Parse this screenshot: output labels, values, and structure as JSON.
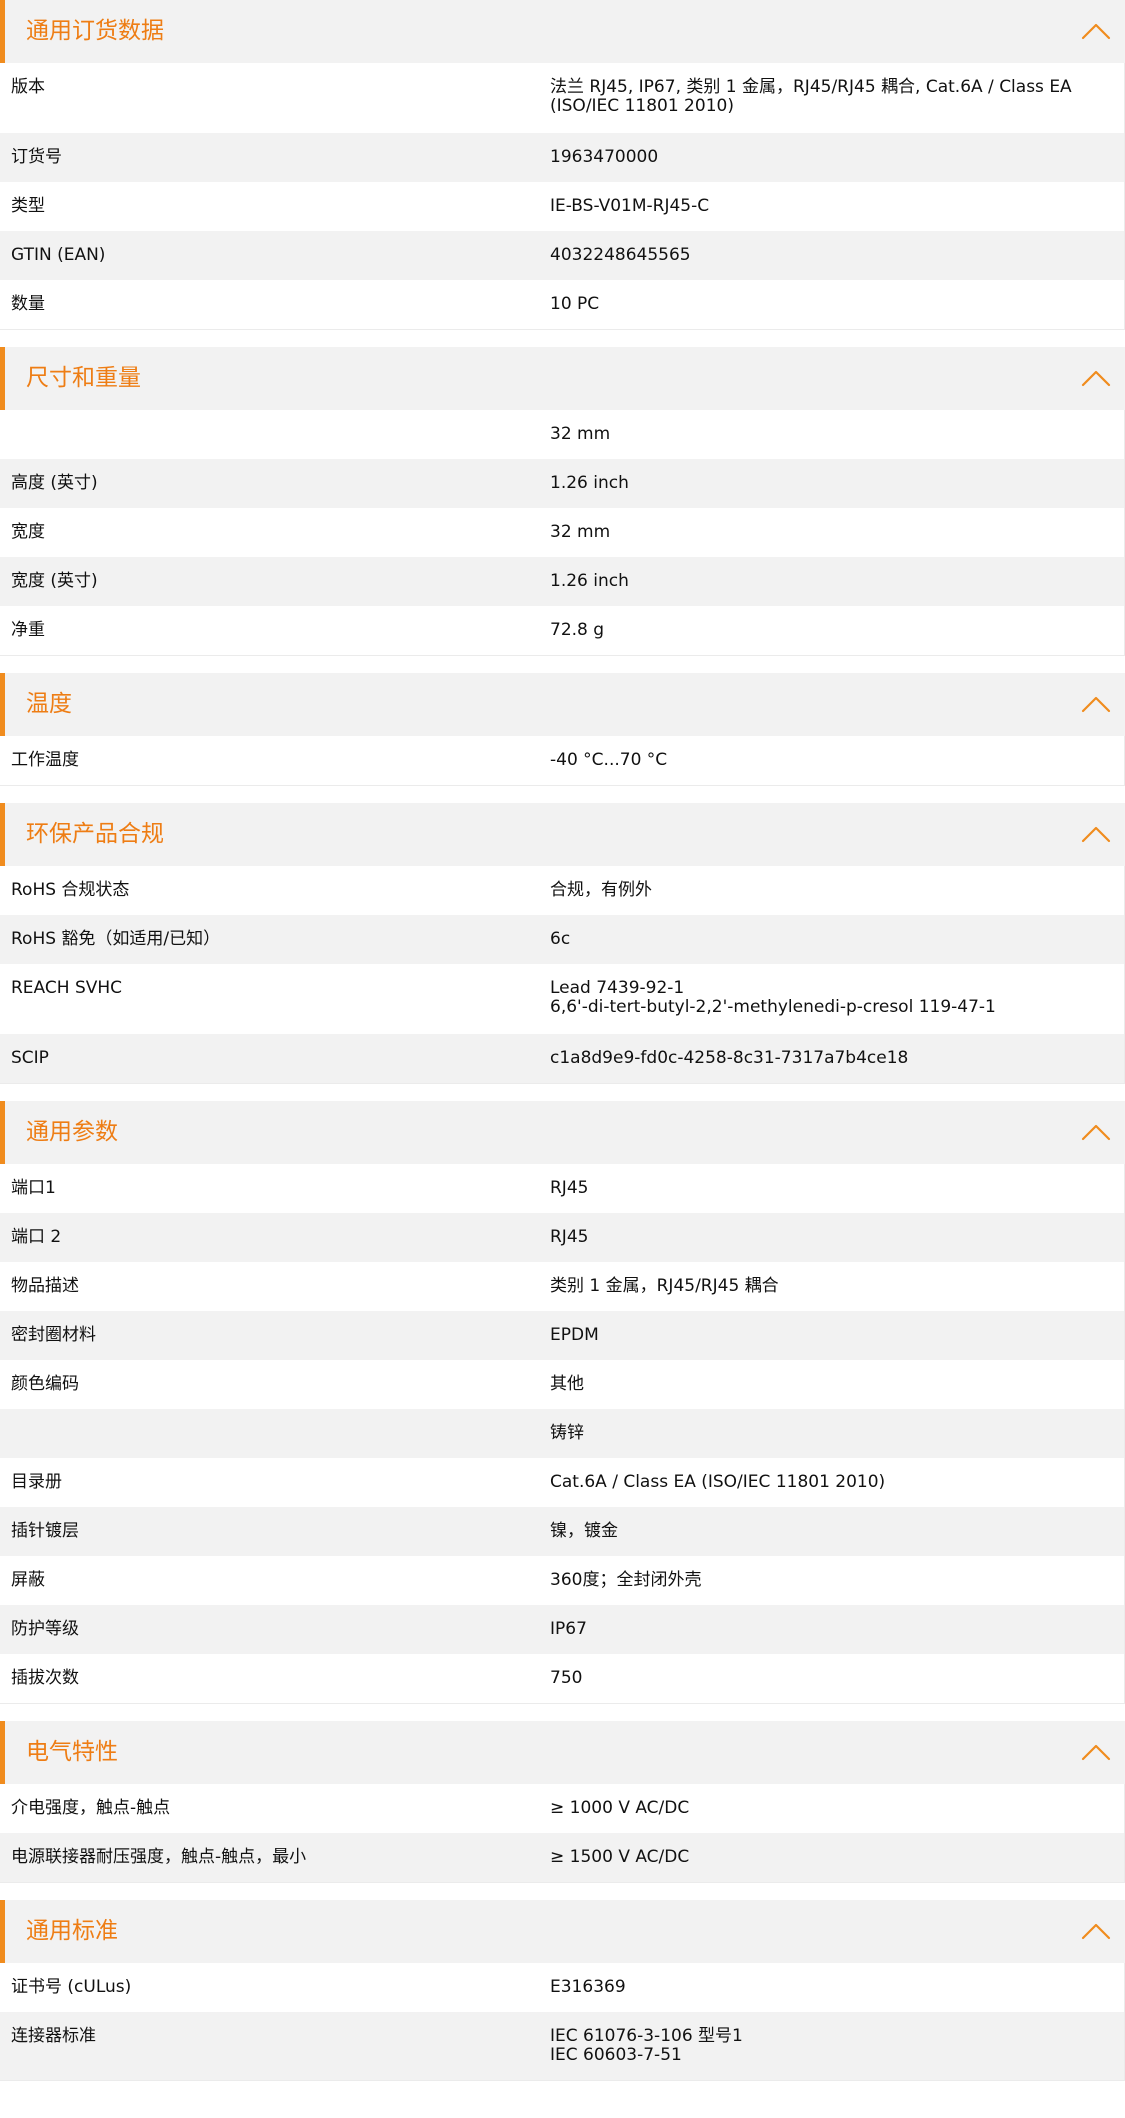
{
  "accent_color": "#f08c1e",
  "collapse_icon": "chevron-up-icon",
  "sections": [
    {
      "title": "通用订货数据",
      "rows": [
        {
          "label": "版本",
          "value": [
            "法兰 RJ45, IP67, 类别 1 金属，RJ45/RJ45 耦合, Cat.6A / Class EA",
            "(ISO/IEC 11801 2010)"
          ]
        },
        {
          "label": "订货号",
          "value": [
            "1963470000"
          ]
        },
        {
          "label": "类型",
          "value": [
            "IE-BS-V01M-RJ45-C"
          ]
        },
        {
          "label": "GTIN (EAN)",
          "value": [
            "4032248645565"
          ]
        },
        {
          "label": "数量",
          "value": [
            "10  PC"
          ]
        }
      ]
    },
    {
      "title": "尺寸和重量",
      "rows": [
        {
          "label": "",
          "value": [
            "32  mm"
          ]
        },
        {
          "label": "高度 (英寸)",
          "value": [
            "1.26  inch"
          ]
        },
        {
          "label": "宽度",
          "value": [
            "32  mm"
          ]
        },
        {
          "label": "宽度 (英寸)",
          "value": [
            "1.26  inch"
          ]
        },
        {
          "label": "净重",
          "value": [
            "72.8  g"
          ]
        }
      ]
    },
    {
      "title": "温度",
      "rows": [
        {
          "label": "工作温度",
          "value": [
            "-40 °C...70 °C"
          ]
        }
      ]
    },
    {
      "title": "环保产品合规",
      "rows": [
        {
          "label": "RoHS 合规状态",
          "value": [
            "合规，有例外"
          ]
        },
        {
          "label": "RoHS 豁免（如适用/已知）",
          "value": [
            "6c"
          ]
        },
        {
          "label": "REACH SVHC",
          "value": [
            "Lead 7439-92-1",
            "6,6'-di-tert-butyl-2,2'-methylenedi-p-cresol 119-47-1"
          ]
        },
        {
          "label": "SCIP",
          "value": [
            "c1a8d9e9-fd0c-4258-8c31-7317a7b4ce18"
          ]
        }
      ]
    },
    {
      "title": "通用参数",
      "rows": [
        {
          "label": "端口1",
          "value": [
            "RJ45"
          ]
        },
        {
          "label": "端口 2",
          "value": [
            "RJ45"
          ]
        },
        {
          "label": "物品描述",
          "value": [
            "类别 1 金属，RJ45/RJ45 耦合"
          ]
        },
        {
          "label": "密封圈材料",
          "value": [
            "EPDM"
          ]
        },
        {
          "label": "颜色编码",
          "value": [
            "其他"
          ]
        },
        {
          "label": "",
          "value": [
            "铸锌"
          ]
        },
        {
          "label": "目录册",
          "value": [
            "Cat.6A / Class EA (ISO/IEC 11801 2010)"
          ]
        },
        {
          "label": "插针镀层",
          "value": [
            "镍，镀金"
          ]
        },
        {
          "label": "屏蔽",
          "value": [
            "360度；全封闭外壳"
          ]
        },
        {
          "label": "防护等级",
          "value": [
            "IP67"
          ]
        },
        {
          "label": "插拔次数",
          "value": [
            "750"
          ]
        }
      ]
    },
    {
      "title": "电气特性",
      "rows": [
        {
          "label": "介电强度，触点-触点",
          "value": [
            "≥ 1000 V AC/DC"
          ]
        },
        {
          "label": "电源联接器耐压强度，触点-触点，最小",
          "value": [
            "≥ 1500 V AC/DC"
          ]
        }
      ]
    },
    {
      "title": "通用标准",
      "rows": [
        {
          "label": "证书号 (cULus)",
          "value": [
            "E316369"
          ]
        },
        {
          "label": "连接器标准",
          "value": [
            "IEC 61076-3-106 型号1",
            "IEC 60603-7-51"
          ]
        }
      ]
    }
  ]
}
